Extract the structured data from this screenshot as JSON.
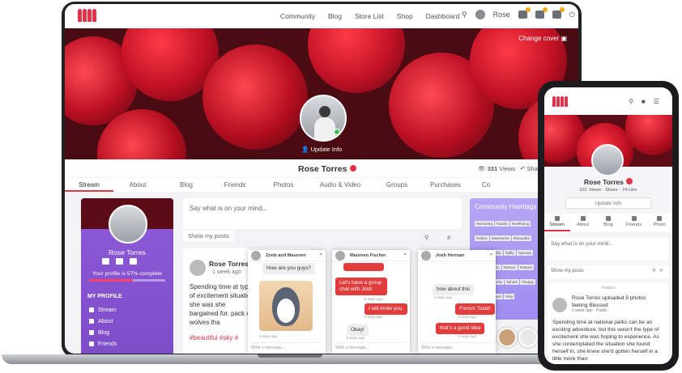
{
  "nav": {
    "links": [
      "Community",
      "Blog",
      "Store List",
      "Shop",
      "Dashboard"
    ],
    "user_name": "Rose"
  },
  "profile": {
    "change_cover": "Change cover",
    "update_info": "Update Info",
    "name": "Rose Torres",
    "views": "331",
    "views_label": "Views",
    "share": "Share",
    "likes": "74",
    "like_label": "Like"
  },
  "tabs": [
    "Stream",
    "About",
    "Blog",
    "Friends",
    "Photos",
    "Audio & Video",
    "Groups",
    "Purchases",
    "Co"
  ],
  "sidebar": {
    "name": "Rose Torres",
    "completion_text": "Your profile is 57% complete",
    "completion_percent": 57,
    "my_profile": "MY PROFILE",
    "menu": [
      "Stream",
      "About",
      "Blog",
      "Friends"
    ]
  },
  "stream": {
    "post_placeholder": "Say what is on your mind...",
    "show_my_posts": "Show my posts",
    "post_author": "Rose Torres",
    "post_time": "1 week ago",
    "post_text": "Spending time at type of excitement situation she was she bargained for. pack of wolves tha",
    "post_tags": "#beautiful #sky #"
  },
  "hashtags": {
    "title": "Community Hashtags",
    "tags": [
      "#amazing",
      "#audio",
      "#wellbeing",
      "#video",
      "#awesome",
      "#beautiful",
      "#cute",
      "#family",
      "#gifty",
      "#groups",
      "#fun",
      "#music",
      "#peace",
      "#nature",
      "#good",
      "#lovely",
      "#photo",
      "#happy",
      "#style",
      "#travel",
      "#sky"
    ]
  },
  "chats": [
    {
      "title": "Zoob and Maureen",
      "messages": [
        {
          "text": "How are you guys?",
          "dir": "in"
        },
        {
          "text": "6 days ago",
          "dir": "time"
        }
      ],
      "footer": "Write a message..."
    },
    {
      "title": "Maureen Fischer",
      "messages": [
        {
          "text": "Let's have a group chat with Josh",
          "dir": "out"
        },
        {
          "text": "6 days ago",
          "dir": "time"
        },
        {
          "text": "I will invite you.",
          "dir": "out"
        },
        {
          "text": "6 days ago",
          "dir": "time"
        },
        {
          "text": "Okay!",
          "dir": "in"
        },
        {
          "text": "6 days ago",
          "dir": "time"
        }
      ],
      "footer": "Write a message..."
    },
    {
      "title": "Josh Herman",
      "messages": [
        {
          "text": "how about this",
          "dir": "in"
        },
        {
          "text": "6 days ago",
          "dir": "time"
        },
        {
          "text": "French Toast!",
          "dir": "out"
        },
        {
          "text": "6 days ago",
          "dir": "time"
        },
        {
          "text": "that's a good idea",
          "dir": "out"
        },
        {
          "text": "6 days ago",
          "dir": "time"
        }
      ],
      "footer": "Write a message..."
    }
  ],
  "mobile": {
    "name": "Rose Torres",
    "views": "331 Views",
    "share": "Share",
    "likes": "74 Like",
    "update_info": "Update Info",
    "tabs": [
      "Stream",
      "About",
      "Blog",
      "Friends",
      "Photo"
    ],
    "post_placeholder": "Say what is on your mind...",
    "show_my_posts": "Show my posts",
    "pinned": "PINNED",
    "post_header": "Rose Torres uploaded 9 photos feeling Blessed",
    "post_time": "1 week ago",
    "post_visibility": "Public",
    "post_text": "Spending time at national parks can be an exciting adventure, but this wasn't the type of excitement she was hoping to experience. As she contemplated the situation she found herself in, she knew she'd gotten herself in a little more than"
  },
  "colors": {
    "accent": "#e0344a",
    "sidebar": "#8e5bd8",
    "hashtags": "#a897f2",
    "chat_out": "#e33c3c"
  }
}
